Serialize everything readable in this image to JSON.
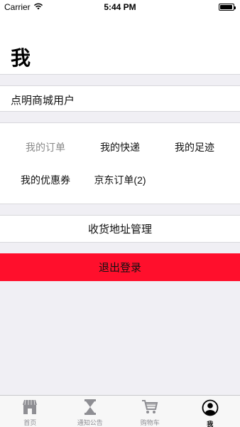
{
  "status_bar": {
    "carrier": "Carrier",
    "time": "5:44 PM",
    "wifi_icon": "wifi-icon",
    "battery_icon": "battery-icon"
  },
  "header": {
    "title": "我"
  },
  "user": {
    "name": "点明商城用户"
  },
  "shortcuts": [
    {
      "label": "我的订单",
      "muted": true
    },
    {
      "label": "我的快递",
      "muted": false
    },
    {
      "label": "我的足迹",
      "muted": false
    },
    {
      "label": "我的优惠券",
      "muted": false
    },
    {
      "label": "京东订单(2)",
      "muted": false
    }
  ],
  "address": {
    "label": "收货地址管理"
  },
  "logout": {
    "label": "退出登录",
    "color": "#ff0f2c"
  },
  "tab_bar": {
    "tabs": [
      {
        "label": "首页",
        "icon": "store-icon",
        "active": false
      },
      {
        "label": "通知公告",
        "icon": "hourglass-icon",
        "active": false
      },
      {
        "label": "购物车",
        "icon": "cart-icon",
        "active": false
      },
      {
        "label": "我",
        "icon": "profile-icon",
        "active": true
      }
    ]
  }
}
